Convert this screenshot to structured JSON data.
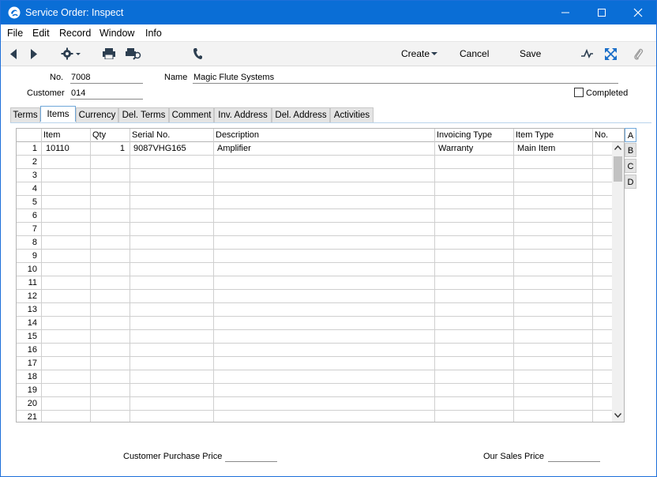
{
  "window": {
    "title": "Service Order: Inspect"
  },
  "menu": [
    "File",
    "Edit",
    "Record",
    "Window",
    "Info"
  ],
  "toolbar": {
    "create_label": "Create",
    "cancel_label": "Cancel",
    "save_label": "Save"
  },
  "header": {
    "no_label": "No.",
    "no_value": "7008",
    "name_label": "Name",
    "name_value": "Magic Flute Systems",
    "customer_label": "Customer",
    "customer_value": "014",
    "completed_label": "Completed",
    "completed_checked": false
  },
  "tabs": [
    "Terms",
    "Items",
    "Currency",
    "Del. Terms",
    "Comment",
    "Inv. Address",
    "Del. Address",
    "Activities"
  ],
  "active_tab": "Items",
  "grid": {
    "columns": [
      "Item",
      "Qty",
      "Serial No.",
      "Description",
      "Invoicing Type",
      "Item Type",
      "No."
    ],
    "rows": [
      {
        "n": "1",
        "item": "10110",
        "qty": "1",
        "serial": "9087VHG165",
        "description": "Amplifier",
        "invoicing_type": "Warranty",
        "item_type": "Main Item",
        "no": ""
      },
      {
        "n": "2"
      },
      {
        "n": "3"
      },
      {
        "n": "4"
      },
      {
        "n": "5"
      },
      {
        "n": "6"
      },
      {
        "n": "7"
      },
      {
        "n": "8"
      },
      {
        "n": "9"
      },
      {
        "n": "10"
      },
      {
        "n": "11"
      },
      {
        "n": "12"
      },
      {
        "n": "13"
      },
      {
        "n": "14"
      },
      {
        "n": "15"
      },
      {
        "n": "16"
      },
      {
        "n": "17"
      },
      {
        "n": "18"
      },
      {
        "n": "19"
      },
      {
        "n": "20"
      },
      {
        "n": "21"
      }
    ]
  },
  "side_tabs": [
    "A",
    "B",
    "C",
    "D"
  ],
  "active_side_tab": "A",
  "footer": {
    "customer_purchase_price_label": "Customer Purchase Price",
    "customer_purchase_price_value": "",
    "our_sales_price_label": "Our Sales Price",
    "our_sales_price_value": ""
  }
}
